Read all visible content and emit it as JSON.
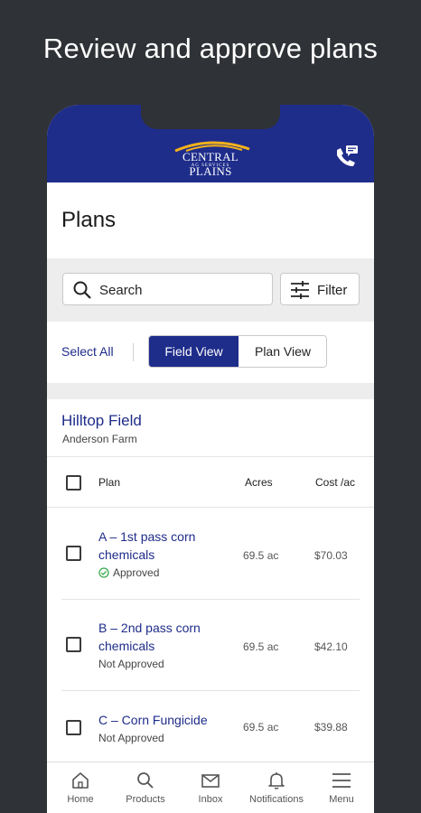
{
  "promo": {
    "title": "Review and approve plans"
  },
  "header": {
    "logo_main": "CENTRAL PLAINS",
    "logo_sub": "AG SERVICES",
    "brand_color": "#1e2c8a",
    "contact_icon": "phone-chat-icon"
  },
  "page": {
    "title": "Plans"
  },
  "search": {
    "placeholder": "Search",
    "icon": "search-icon"
  },
  "filter": {
    "label": "Filter",
    "icon": "sliders-icon"
  },
  "view": {
    "select_all": "Select All",
    "tabs": [
      {
        "label": "Field View",
        "selected": true
      },
      {
        "label": "Plan View",
        "selected": false
      }
    ]
  },
  "field": {
    "name": "Hilltop Field",
    "farm": "Anderson Farm"
  },
  "table": {
    "columns": [
      "Plan",
      "Acres",
      "Cost /ac"
    ],
    "rows": [
      {
        "plan_line1": "A – 1st pass corn",
        "plan_line2": "chemicals",
        "status": "Approved",
        "approved": true,
        "acres": "69.5 ac",
        "cost": "$70.03"
      },
      {
        "plan_line1": "B – 2nd pass corn",
        "plan_line2": "chemicals",
        "status": "Not Approved",
        "approved": false,
        "acres": "69.5 ac",
        "cost": "$42.10"
      },
      {
        "plan_line1": "C – Corn Fungicide",
        "plan_line2": "",
        "status": "Not Approved",
        "approved": false,
        "acres": "69.5 ac",
        "cost": "$39.88"
      }
    ]
  },
  "nav": {
    "items": [
      {
        "label": "Home",
        "icon": "home-icon"
      },
      {
        "label": "Products",
        "icon": "search-icon"
      },
      {
        "label": "Inbox",
        "icon": "mail-icon"
      },
      {
        "label": "Notifications",
        "icon": "bell-icon"
      },
      {
        "label": "Menu",
        "icon": "menu-icon"
      }
    ]
  }
}
